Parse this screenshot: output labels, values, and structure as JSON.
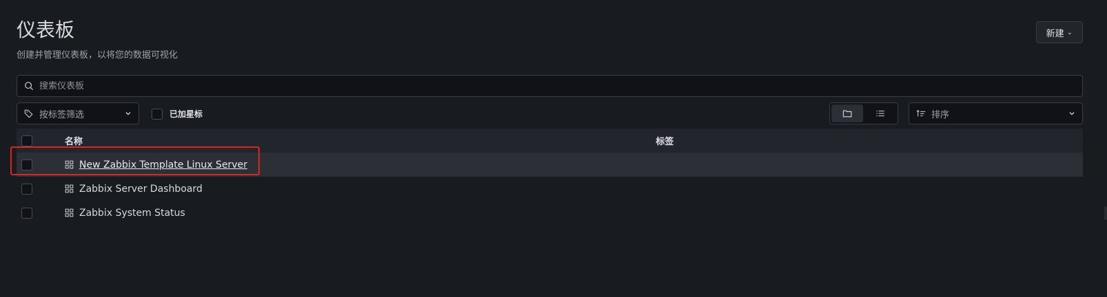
{
  "header": {
    "title": "仪表板",
    "subtitle": "创建并管理仪表板，以将您的数据可视化",
    "new_button": "新建"
  },
  "search": {
    "placeholder": "搜索仪表板",
    "value": ""
  },
  "filters": {
    "tag_filter_placeholder": "按标签筛选",
    "starred_label": "已加星标",
    "sort_placeholder": "排序",
    "view_mode": "folders"
  },
  "table": {
    "columns": {
      "name": "名称",
      "tags": "标签"
    },
    "rows": [
      {
        "name": "New Zabbix Template Linux Server",
        "hovered": true
      },
      {
        "name": "Zabbix Server Dashboard"
      },
      {
        "name": "Zabbix System Status"
      }
    ]
  },
  "colors": {
    "background": "#181b1f",
    "highlight": "#e0261c",
    "header_bg": "#22252b"
  }
}
